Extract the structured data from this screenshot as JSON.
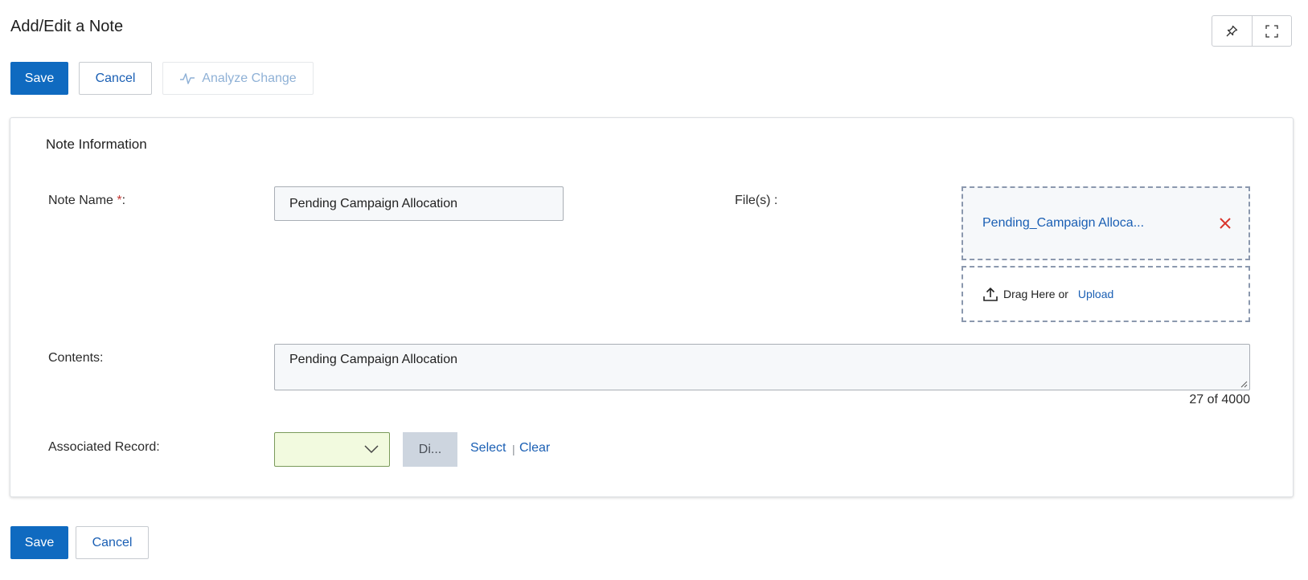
{
  "header": {
    "title": "Add/Edit a Note"
  },
  "toolbar": {
    "save_label": "Save",
    "cancel_label": "Cancel",
    "analyze_label": "Analyze Change"
  },
  "window_controls": {
    "pin_icon": "pin-icon",
    "expand_icon": "expand-icon"
  },
  "section": {
    "title": "Note Information",
    "note_name_label": "Note Name ",
    "required_mark": "*",
    "note_name_colon": ":",
    "note_name_value": "Pending Campaign Allocation",
    "files_label": "File(s) :",
    "file_name": "Pending_Campaign Alloca...",
    "drag_text": "Drag Here or",
    "upload_label": "Upload",
    "contents_label": "Contents:",
    "contents_value": "Pending Campaign Allocation",
    "char_count": "27 of 4000",
    "associated_label": "Associated Record:",
    "di_label": "Di...",
    "select_label": "Select",
    "separator": "|",
    "clear_label": "Clear"
  },
  "footer": {
    "save_label": "Save",
    "cancel_label": "Cancel"
  },
  "colors": {
    "primary": "#0f6ac0",
    "link": "#1a5fb4",
    "remove": "#d9342b",
    "select_bg": "#f2fadf"
  }
}
